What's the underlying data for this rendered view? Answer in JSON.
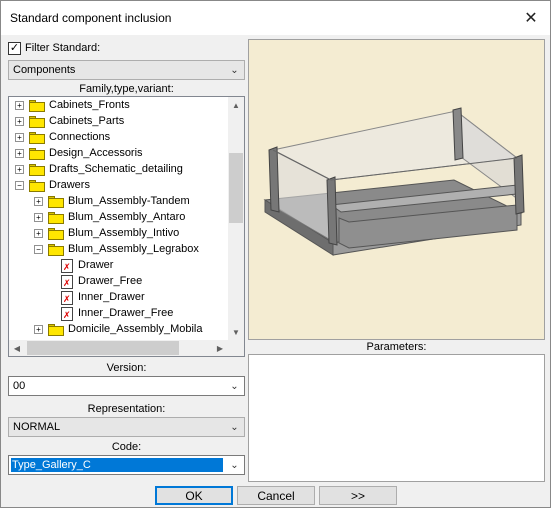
{
  "window": {
    "title": "Standard component inclusion"
  },
  "filter": {
    "checked": true,
    "check_mark": "✓",
    "label": "Filter  Standard:"
  },
  "standard_combo": {
    "value": "Components"
  },
  "tree": {
    "caption": "Family,type,variant:",
    "items": [
      {
        "label": "Cabinets_Fronts",
        "expander": "+",
        "kind": "folder"
      },
      {
        "label": "Cabinets_Parts",
        "expander": "+",
        "kind": "folder"
      },
      {
        "label": "Connections",
        "expander": "+",
        "kind": "folder"
      },
      {
        "label": "Design_Accessoris",
        "expander": "+",
        "kind": "folder"
      },
      {
        "label": "Drafts_Schematic_detailing",
        "expander": "+",
        "kind": "folder"
      },
      {
        "label": "Drawers",
        "expander": "−",
        "kind": "folder"
      },
      {
        "label": "Blum_Assembly-Tandem",
        "expander": "+",
        "kind": "folder"
      },
      {
        "label": "Blum_Assembly_Antaro",
        "expander": "+",
        "kind": "folder"
      },
      {
        "label": "Blum_Assembly_Intivo",
        "expander": "+",
        "kind": "folder"
      },
      {
        "label": "Blum_Assembly_Legrabox",
        "expander": "−",
        "kind": "folder"
      },
      {
        "label": "Drawer",
        "kind": "doc"
      },
      {
        "label": "Drawer_Free",
        "kind": "doc"
      },
      {
        "label": "Inner_Drawer",
        "kind": "doc"
      },
      {
        "label": "Inner_Drawer_Free",
        "kind": "doc"
      },
      {
        "label": "Domicile_Assembly_Mobila",
        "expander": "+",
        "kind": "folder"
      }
    ]
  },
  "version": {
    "caption": "Version:",
    "value": "00"
  },
  "representation": {
    "caption": "Representation:",
    "value": "NORMAL"
  },
  "code": {
    "caption": "Code:",
    "value": "Type_Gallery_C"
  },
  "parameters": {
    "caption": "Parameters:"
  },
  "buttons": {
    "ok": "OK",
    "cancel": "Cancel",
    "next": ">>"
  },
  "icons": {
    "close": "close-icon",
    "chevron": "chevron-down-icon",
    "scroll_up": "▲",
    "scroll_down": "▼",
    "scroll_left": "◀",
    "scroll_right": "▶",
    "chevron_glyph": "⌄",
    "close_glyph": "✕",
    "doc_mark": "✗"
  },
  "colors": {
    "preview_bg": "#f4ecd2",
    "selection": "#0078d7",
    "folder": "#ffe600"
  }
}
